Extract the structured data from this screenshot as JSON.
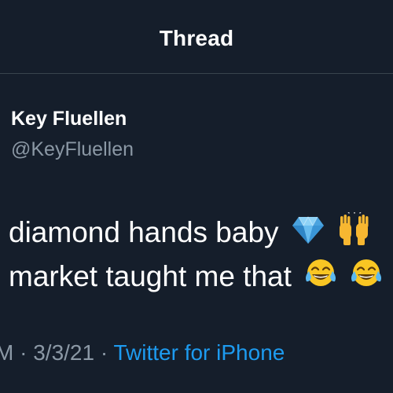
{
  "header": {
    "title": "Thread"
  },
  "tweet": {
    "author": {
      "display_name": "Key Fluellen",
      "handle": "@KeyFluellen"
    },
    "lines": [
      {
        "text": "diamond hands baby",
        "emojis": [
          "gem-stone-icon",
          "raising-hands-icon"
        ]
      },
      {
        "text": "market taught me that",
        "emojis": [
          "tears-of-joy-icon",
          "tears-of-joy-icon"
        ]
      }
    ],
    "meta": {
      "time_fragment": "M",
      "separator": "·",
      "date": "3/3/21",
      "source": "Twitter for iPhone"
    }
  },
  "colors": {
    "background": "#151e2b",
    "secondary_text": "#8b98a5",
    "link": "#1d9bf0",
    "divider": "#38444d"
  }
}
